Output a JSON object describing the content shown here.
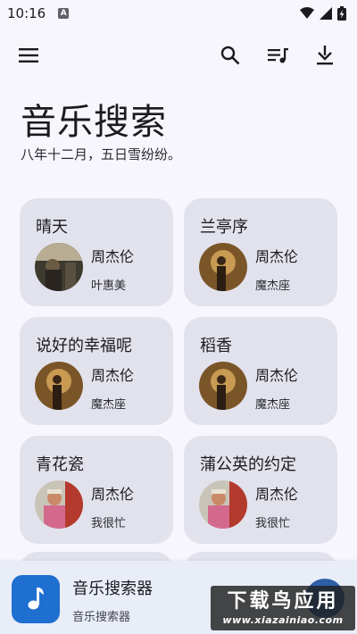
{
  "status_bar": {
    "time": "10:16",
    "notification_letter": "A"
  },
  "page": {
    "title": "音乐搜索",
    "subtitle": "八年十二月，五日雪纷纷。"
  },
  "songs": [
    {
      "title": "晴天",
      "artist": "周杰伦",
      "album": "叶惠美",
      "cover": "cover-a"
    },
    {
      "title": "兰亭序",
      "artist": "周杰伦",
      "album": "魔杰座",
      "cover": "cover-b"
    },
    {
      "title": "说好的幸福呢",
      "artist": "周杰伦",
      "album": "魔杰座",
      "cover": "cover-b"
    },
    {
      "title": "稻香",
      "artist": "周杰伦",
      "album": "魔杰座",
      "cover": "cover-b"
    },
    {
      "title": "青花瓷",
      "artist": "周杰伦",
      "album": "我很忙",
      "cover": "cover-c"
    },
    {
      "title": "蒲公英的约定",
      "artist": "周杰伦",
      "album": "我很忙",
      "cover": "cover-c"
    }
  ],
  "player": {
    "app_name": "音乐搜索器",
    "subtitle": "音乐搜索器",
    "icon": "music-note-icon"
  },
  "watermark": {
    "main": "下载鸟应用",
    "url": "www.xiazainiao.com"
  },
  "colors": {
    "background": "#f7f6fd",
    "card": "#e2e2ec",
    "bottom_bar": "#e8edf8",
    "accent": "#1e6fd0"
  }
}
